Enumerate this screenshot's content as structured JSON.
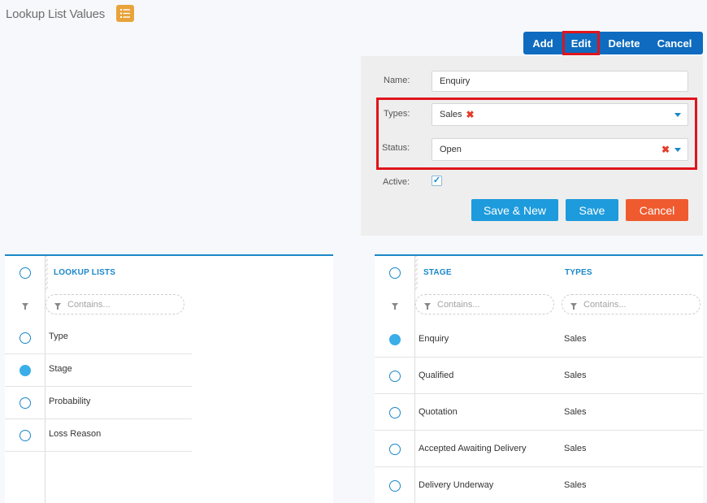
{
  "page": {
    "title": "Lookup List Values"
  },
  "toolbar": {
    "add": "Add",
    "edit": "Edit",
    "delete": "Delete",
    "cancel": "Cancel"
  },
  "form": {
    "name_label": "Name:",
    "name_value": "Enquiry",
    "types_label": "Types:",
    "types_value": "Sales",
    "status_label": "Status:",
    "status_value": "Open",
    "active_label": "Active:",
    "active_checked": true,
    "save_new": "Save & New",
    "save": "Save",
    "cancel": "Cancel"
  },
  "left_grid": {
    "header": "LOOKUP LISTS",
    "filter_placeholder": "Contains...",
    "rows": [
      {
        "label": "Type",
        "selected": false
      },
      {
        "label": "Stage",
        "selected": true
      },
      {
        "label": "Probability",
        "selected": false
      },
      {
        "label": "Loss Reason",
        "selected": false
      }
    ]
  },
  "right_grid": {
    "headers": {
      "stage": "STAGE",
      "types": "TYPES"
    },
    "filter_placeholder": "Contains...",
    "rows": [
      {
        "stage": "Enquiry",
        "types": "Sales",
        "selected": true
      },
      {
        "stage": "Qualified",
        "types": "Sales",
        "selected": false
      },
      {
        "stage": "Quotation",
        "types": "Sales",
        "selected": false
      },
      {
        "stage": "Accepted Awaiting Delivery",
        "types": "Sales",
        "selected": false
      },
      {
        "stage": "Delivery Underway",
        "types": "Sales",
        "selected": false
      }
    ]
  },
  "colors": {
    "accent": "#1a87c9",
    "toolbar": "#0e6bbf",
    "save": "#1d9bdc",
    "cancel": "#f05a2f",
    "highlight": "#e0141b",
    "icon_button": "#e8a33a"
  }
}
